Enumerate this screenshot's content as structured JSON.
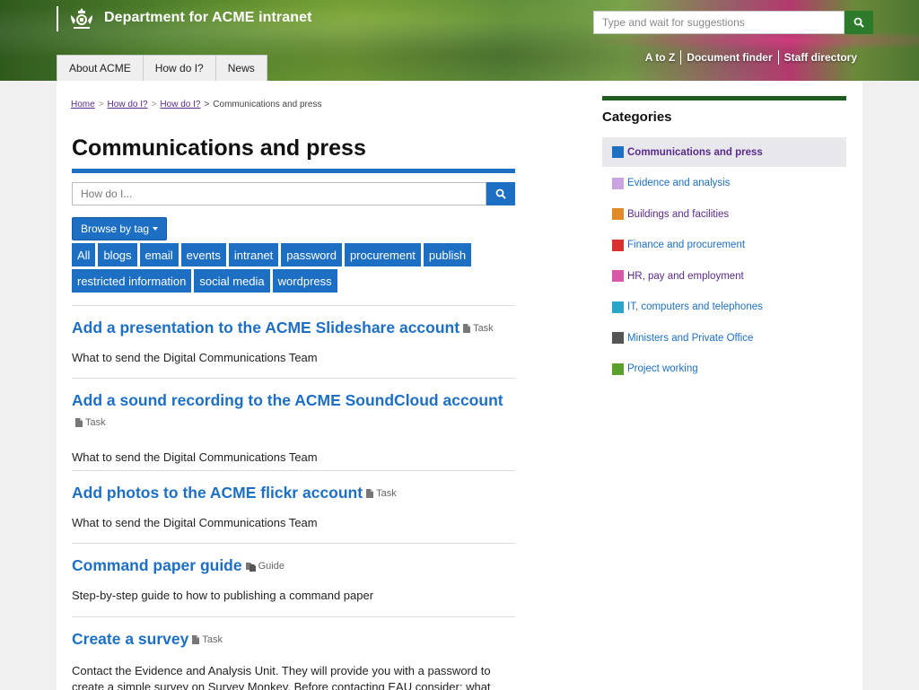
{
  "header": {
    "brand": "Department for ACME intranet",
    "search_placeholder": "Type and wait for suggestions",
    "nav_tabs": [
      "About ACME",
      "How do I?",
      "News"
    ],
    "utility_links": [
      "A to Z",
      "Document finder",
      "Staff directory"
    ]
  },
  "breadcrumb": {
    "home": "Home",
    "crumb1": "How do I?",
    "crumb2": "How do I?",
    "separator": ">",
    "current": "Communications and press"
  },
  "page": {
    "title": "Communications and press",
    "howdo_placeholder": "How do I...",
    "browse_label": "Browse by tag"
  },
  "tags": [
    "All",
    "blogs",
    "email",
    "events",
    "intranet",
    "password",
    "procurement",
    "publish",
    "restricted information",
    "social media",
    "wordpress"
  ],
  "results": [
    {
      "title": "Add a presentation to the ACME Slideshare account",
      "type": "Task",
      "icon": "document-icon",
      "desc": "What to send the Digital Communications Team"
    },
    {
      "title": "Add a sound recording to the ACME SoundCloud account",
      "type": "Task",
      "icon": "document-icon",
      "desc": "What to send the Digital Communications Team"
    },
    {
      "title": "Add photos to the ACME flickr account",
      "type": "Task",
      "icon": "document-icon",
      "desc": "What to send the Digital Communications Team"
    },
    {
      "title": "Command paper guide",
      "type": "Guide",
      "icon": "documents-icon",
      "desc": "Step-by-step guide to how to publishing a command paper"
    },
    {
      "title": "Create a survey",
      "type": "Task",
      "icon": "document-icon",
      "desc": "Contact the Evidence and Analysis Unit. They will provide you with a password to create a simple survey on Survey Monkey. Before contacting EAU consider: what"
    }
  ],
  "sidebar": {
    "heading": "Categories",
    "categories": [
      {
        "label": "Communications and press",
        "color": "#1d6fc4"
      },
      {
        "label": "Evidence and analysis",
        "color": "#c9a4e0"
      },
      {
        "label": "Buildings and facilities",
        "color": "#e08a2a"
      },
      {
        "label": "Finance and procurement",
        "color": "#d93030"
      },
      {
        "label": "HR, pay and employment",
        "color": "#d957a8"
      },
      {
        "label": "IT, computers and telephones",
        "color": "#2aa6c9"
      },
      {
        "label": "Ministers and Private Office",
        "color": "#555555"
      },
      {
        "label": "Project working",
        "color": "#5aa02a"
      }
    ]
  },
  "colors": {
    "link_blue": "#1d6fc4",
    "visited_purple": "#5a2a8a",
    "search_green": "#2b7b2b",
    "sidebar_rule": "#1f5c1f"
  }
}
